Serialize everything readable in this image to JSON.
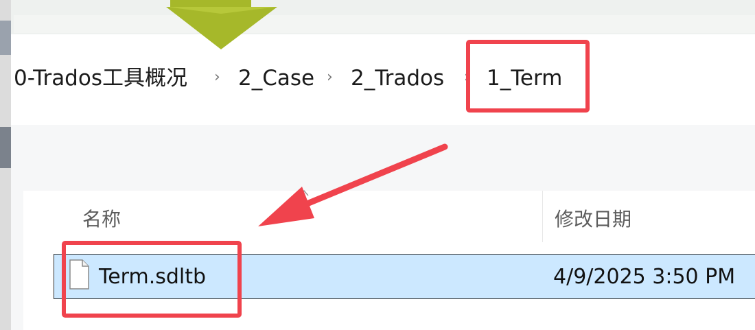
{
  "breadcrumb": {
    "items": [
      "0-Trados工具概况",
      "2_Case",
      "2_Trados",
      "1_Term"
    ],
    "separator": "›"
  },
  "file_list": {
    "columns": {
      "name": "名称",
      "modified": "修改日期"
    },
    "rows": [
      {
        "name": "Term.sdltb",
        "modified": "4/9/2025 3:50 PM",
        "selected": true
      }
    ]
  },
  "annotations": {
    "highlight_color": "#f0434d",
    "arrow_color": "#f0434d",
    "pointer_color": "#a6b82a"
  },
  "colors": {
    "selection_bg": "#cce8ff"
  }
}
